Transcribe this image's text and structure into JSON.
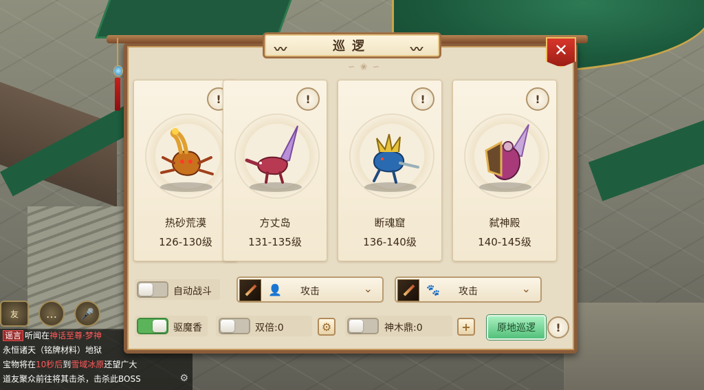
{
  "dialog": {
    "title": "巡逻",
    "close_label": "✕"
  },
  "areas": [
    {
      "name": "热砂荒漠",
      "level": "126-130级",
      "info": "!"
    },
    {
      "name": "方丈岛",
      "level": "131-135级",
      "info": "!"
    },
    {
      "name": "断魂窟",
      "level": "136-140级",
      "info": "!"
    },
    {
      "name": "弑神殿",
      "level": "140-145级",
      "info": "!"
    }
  ],
  "controls": {
    "auto_battle": {
      "label": "自动战斗",
      "on": false
    },
    "role_skill": {
      "icon": "person-icon",
      "value": "攻击"
    },
    "pet_skill": {
      "icon": "paw-icon",
      "value": "攻击"
    },
    "repel_incense": {
      "label": "驱魔香",
      "on": true
    },
    "double": {
      "label": "双倍:0",
      "on": false
    },
    "shenmuding": {
      "label": "神木鼎:0",
      "on": false
    },
    "patrol_button": "原地巡逻",
    "help": "!"
  },
  "hud": {
    "chat_lines": [
      {
        "tag": "谣言",
        "parts": [
          "听闻在",
          "神话至尊·梦神",
          ""
        ]
      },
      {
        "text": "永恒诸天（铭牌材料）地狱"
      },
      {
        "parts": [
          "宝物将在",
          "10秒后",
          "到",
          "雪域冰原",
          "还望广大"
        ]
      },
      {
        "text": "道友聚众前往将其击杀，击杀此BOSS"
      }
    ]
  },
  "colors": {
    "accent_green": "#52c07a",
    "frame_brown": "#8a5c3a",
    "close_red": "#d8362a"
  }
}
